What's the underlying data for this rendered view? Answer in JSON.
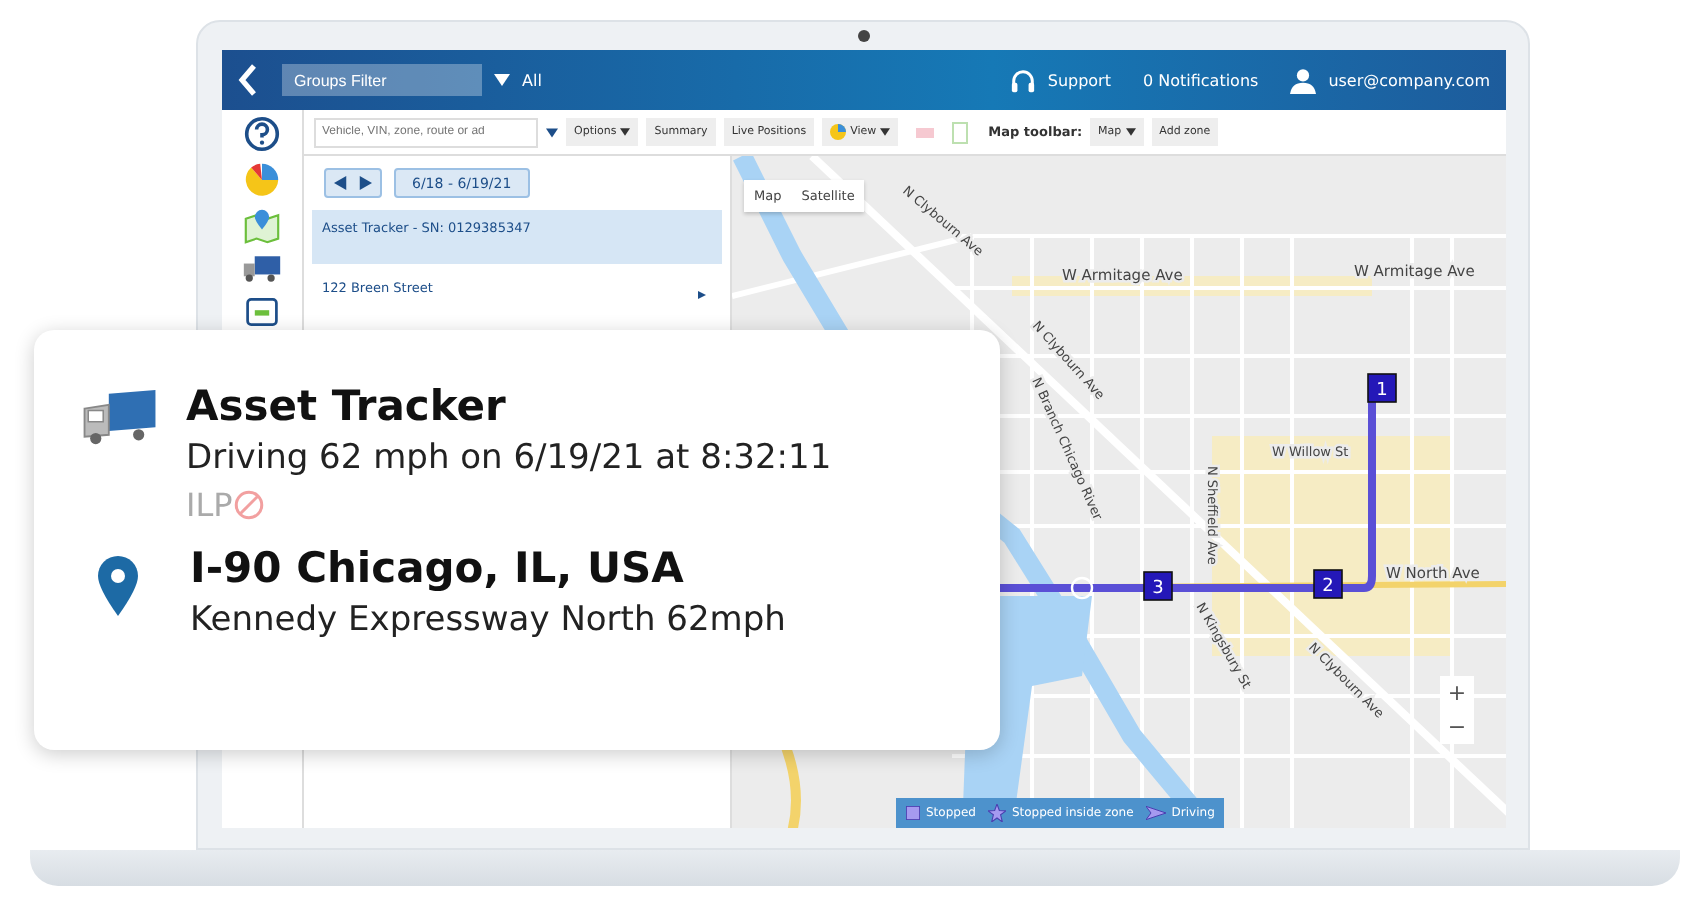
{
  "header": {
    "groups_filter": {
      "placeholder": "Groups Filter"
    },
    "scope": "All",
    "support": "Support",
    "notifications": "0 Notifications",
    "user": "user@company.com"
  },
  "toolbar": {
    "search": {
      "placeholder": "Vehicle, VIN, zone, route or ad"
    },
    "buttons": [
      {
        "label": "Options",
        "dropdown": true
      },
      {
        "label": "Summary",
        "dropdown": false
      },
      {
        "label": "Live Positions",
        "dropdown": false
      },
      {
        "label": "View",
        "dropdown": true
      }
    ],
    "map_toolbar_label": "Map toolbar:",
    "map_buttons": [
      {
        "label": "Map",
        "dropdown": true
      },
      {
        "label": "Add zone",
        "dropdown": false
      }
    ]
  },
  "date_range": "6/18 - 6/19/21",
  "trips": [
    {
      "title": "Asset Tracker - SN: 0129385347",
      "selected": true
    },
    {
      "title": "122 Breen Street",
      "selected": false
    }
  ],
  "map": {
    "view_tabs": [
      "Map",
      "Satellite"
    ],
    "street_labels": [
      "N Clybourn Ave",
      "W Armitage Ave",
      "W Armitage Ave",
      "N Clybourn Ave",
      "N Branch Chicago River",
      "W Willow St",
      "N Sheffield Ave",
      "W North Ave",
      "N Kingsbury St",
      "N Clybourn Ave"
    ],
    "stops": [
      "1",
      "2",
      "3"
    ],
    "zoom_in": "+",
    "zoom_out": "−",
    "legend": [
      {
        "kind": "stopped",
        "label": "Stopped"
      },
      {
        "kind": "zone",
        "label": "Stopped inside zone"
      },
      {
        "kind": "driving",
        "label": "Driving"
      }
    ]
  },
  "card": {
    "title": "Asset Tracker",
    "status": "Driving 62 mph on 6/19/21 at 8:32:11",
    "plate": "ILP",
    "location": "I-90 Chicago, IL, USA",
    "road": "Kennedy Expressway North 62mph"
  }
}
